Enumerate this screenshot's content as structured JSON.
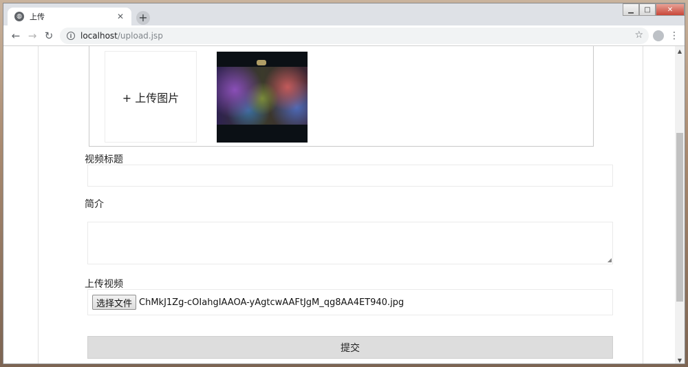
{
  "browser": {
    "tab": {
      "title": "上传",
      "favicon": "globe-icon"
    },
    "new_tab_symbol": "+",
    "window_controls": {
      "minimize": "▁",
      "maximize": "□",
      "close": "✕"
    },
    "address": {
      "host": "localhost",
      "path": "/upload.jsp"
    },
    "icons": [
      "back-arrow-icon",
      "forward-arrow-icon",
      "reload-icon",
      "info-icon",
      "star-icon",
      "profile-icon",
      "menu-icon"
    ]
  },
  "form": {
    "cover": {
      "upload_label": "+ 上传图片"
    },
    "title_field": {
      "label": "视频标题",
      "value": ""
    },
    "intro_field": {
      "label": "简介",
      "value": ""
    },
    "video_field": {
      "label": "上传视频",
      "button_label": "选择文件",
      "file_name": "ChMkJ1Zg-cOIahgIAAOA-yAgtcwAAFtJgM_qg8AA4ET940.jpg"
    },
    "submit_label": "提交"
  }
}
